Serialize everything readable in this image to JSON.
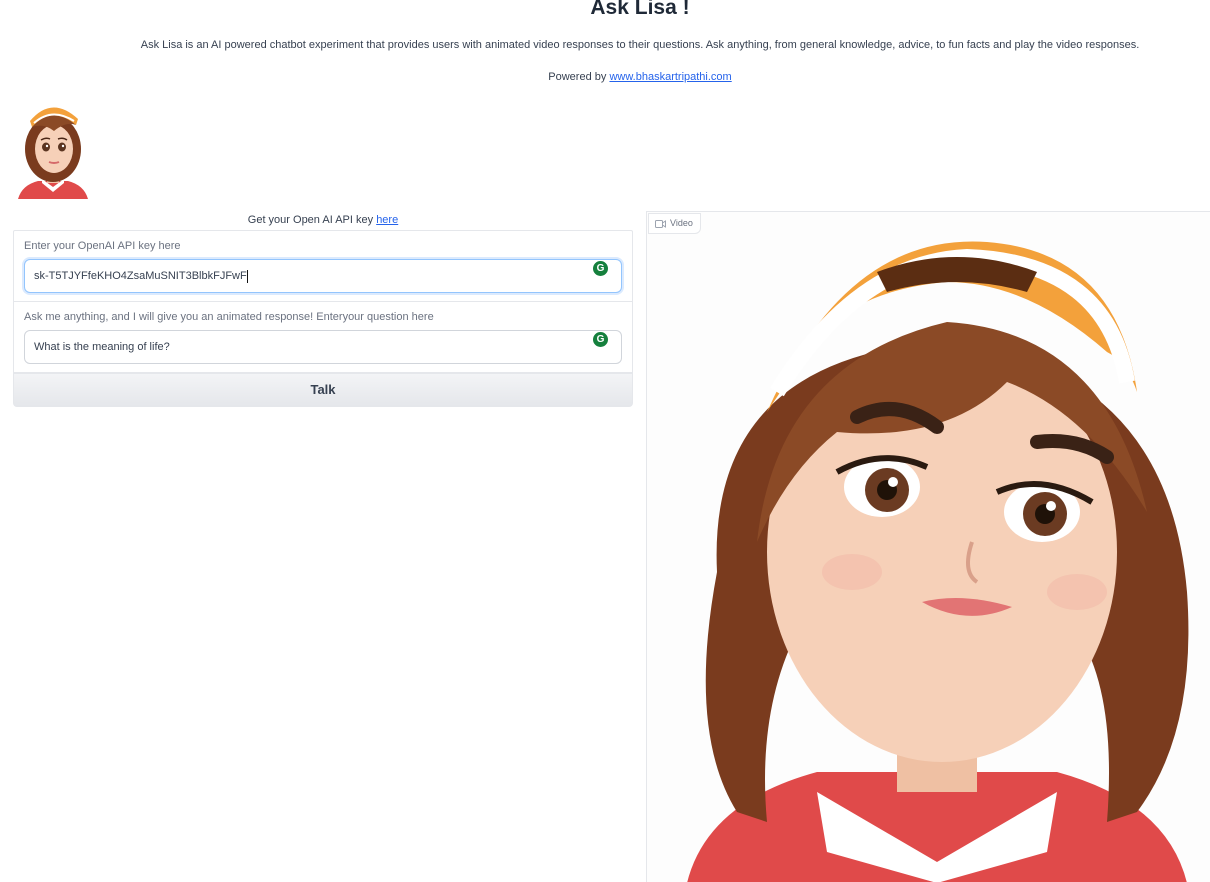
{
  "header": {
    "title": "Ask Lisa !",
    "description": "Ask Lisa is an AI powered chatbot experiment that provides users with animated video responses to their questions. Ask anything, from general knowledge, advice, to fun facts and play the video responses.",
    "powered_prefix": "Powered by",
    "powered_link": "www.bhaskartripathi.com"
  },
  "form": {
    "key_link_prefix": "Get your Open AI API key",
    "key_link_text": "here",
    "api_key_label": "Enter your OpenAI API key here",
    "api_key_value": "sk-T5TJYFfeKHO4ZsaMuSNIT3BlbkFJFwF",
    "question_label": "Ask me anything, and I will give you an animated response! Enteryour question here",
    "question_value": "What is the meaning of life?",
    "talk_label": "Talk"
  },
  "video": {
    "tag_label": "Video",
    "tag_icon": "video-camera-icon"
  },
  "colors": {
    "link": "#2563eb",
    "cap": "#f3a13b",
    "hair": "#7a3b1e",
    "shirt": "#e04a4a"
  }
}
